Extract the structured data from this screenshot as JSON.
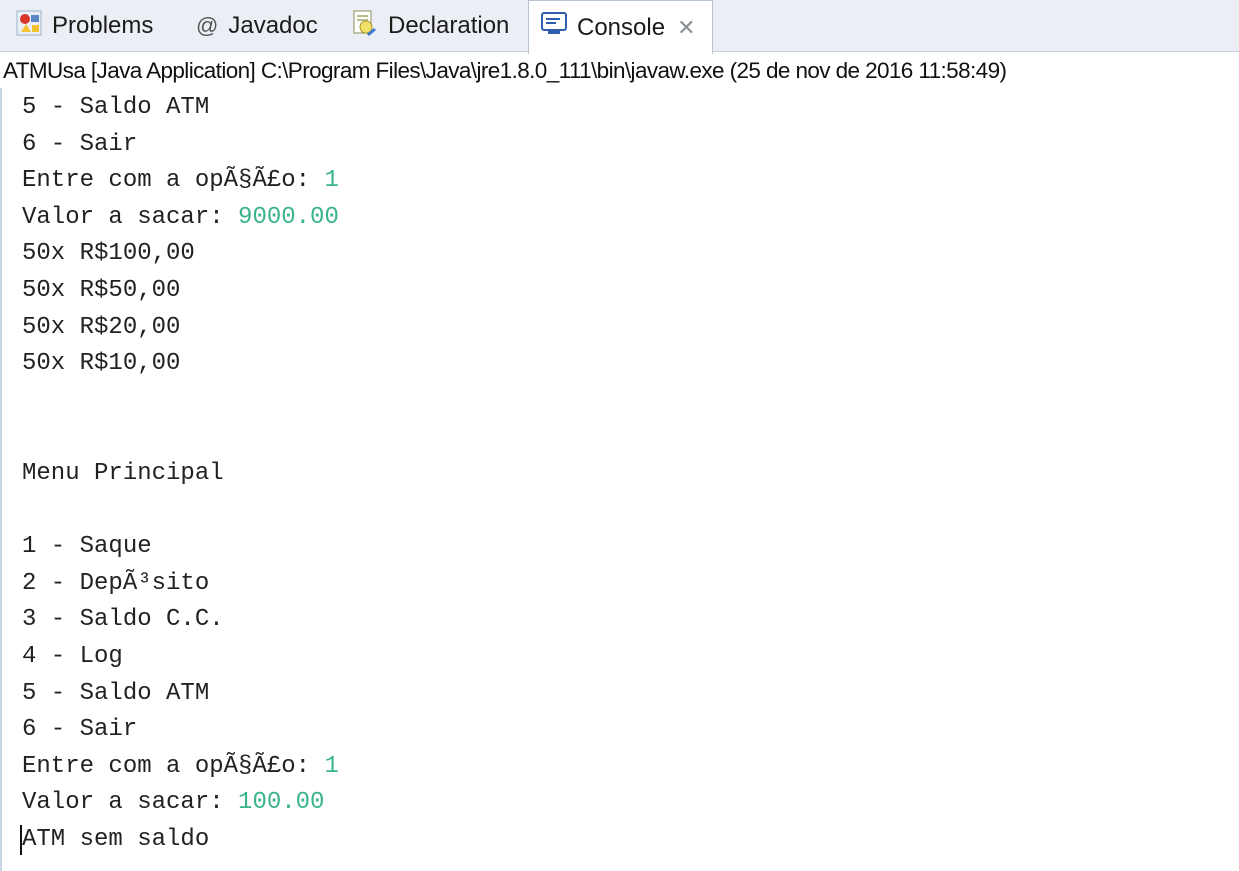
{
  "tabs": {
    "problems": {
      "label": "Problems",
      "icon": "problems-icon"
    },
    "javadoc": {
      "label": "Javadoc",
      "icon": "at-sign-icon"
    },
    "declaration": {
      "label": "Declaration",
      "icon": "declaration-icon"
    },
    "console": {
      "label": "Console",
      "icon": "console-icon",
      "active": true
    }
  },
  "console_title": "ATMUsa [Java Application] C:\\Program Files\\Java\\jre1.8.0_111\\bin\\javaw.exe (25 de nov de 2016 11:58:49)",
  "colors": {
    "user_input": "#3ab48a",
    "tab_bar": "#ebeff5"
  },
  "lines": [
    {
      "text": "5 - Saldo ATM"
    },
    {
      "text": "6 - Sair"
    },
    {
      "text": "Entre com a opÃ§Ã£o: ",
      "input": "1"
    },
    {
      "text": "Valor a sacar: ",
      "input": "9000.00"
    },
    {
      "text": "50x R$100,00"
    },
    {
      "text": "50x R$50,00"
    },
    {
      "text": "50x R$20,00"
    },
    {
      "text": "50x R$10,00"
    },
    {
      "text": ""
    },
    {
      "text": ""
    },
    {
      "text": "Menu Principal"
    },
    {
      "text": ""
    },
    {
      "text": "1 - Saque"
    },
    {
      "text": "2 - DepÃ³sito"
    },
    {
      "text": "3 - Saldo C.C."
    },
    {
      "text": "4 - Log"
    },
    {
      "text": "5 - Saldo ATM"
    },
    {
      "text": "6 - Sair"
    },
    {
      "text": "Entre com a opÃ§Ã£o: ",
      "input": "1"
    },
    {
      "text": "Valor a sacar: ",
      "input": "100.00"
    },
    {
      "text": "ATM sem saldo"
    }
  ]
}
